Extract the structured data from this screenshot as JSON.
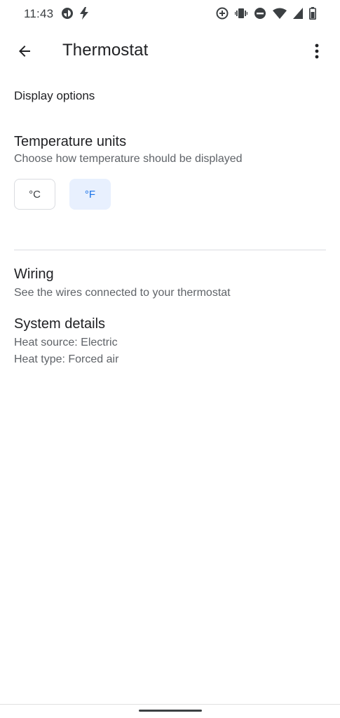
{
  "status_bar": {
    "time": "11:43",
    "icons": [
      "data-saver-icon",
      "flash-icon",
      "add-circle-icon",
      "vibrate-icon",
      "do-not-disturb-icon",
      "wifi-icon",
      "cell-signal-icon",
      "battery-icon"
    ]
  },
  "app_bar": {
    "title": "Thermostat",
    "back_icon": "arrow-back-icon",
    "more_icon": "more-vert-icon"
  },
  "display_options": {
    "header": "Display options",
    "temperature_units": {
      "title": "Temperature units",
      "subtitle": "Choose how temperature should be displayed",
      "options": [
        {
          "label": "°C",
          "selected": false
        },
        {
          "label": "°F",
          "selected": true
        }
      ]
    }
  },
  "wiring": {
    "title": "Wiring",
    "subtitle": "See the wires connected to your thermostat"
  },
  "system_details": {
    "title": "System details",
    "heat_source": "Heat source: Electric",
    "heat_type": "Heat type: Forced air"
  },
  "colors": {
    "accent": "#1a73e8",
    "selected_bg": "#e8f0fe",
    "divider": "#dadce0",
    "secondary_text": "#5f6368"
  }
}
